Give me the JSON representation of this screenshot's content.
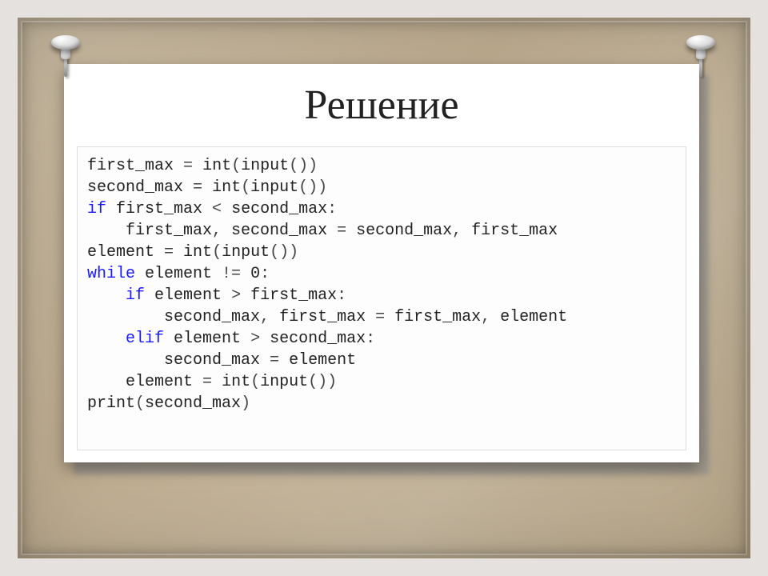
{
  "heading": "Решение",
  "code": {
    "lines": [
      [
        [
          "nm",
          "first_max "
        ],
        [
          "op",
          "="
        ],
        [
          "nm",
          " "
        ],
        [
          "fn",
          "int"
        ],
        [
          "op",
          "("
        ],
        [
          "fn",
          "input"
        ],
        [
          "op",
          "())"
        ]
      ],
      [
        [
          "nm",
          "second_max "
        ],
        [
          "op",
          "="
        ],
        [
          "nm",
          " "
        ],
        [
          "fn",
          "int"
        ],
        [
          "op",
          "("
        ],
        [
          "fn",
          "input"
        ],
        [
          "op",
          "())"
        ]
      ],
      [
        [
          "kw",
          "if"
        ],
        [
          "nm",
          " first_max "
        ],
        [
          "op",
          "<"
        ],
        [
          "nm",
          " second_max"
        ],
        [
          "op",
          ":"
        ]
      ],
      [
        [
          "nm",
          "    first_max"
        ],
        [
          "op",
          ","
        ],
        [
          "nm",
          " second_max "
        ],
        [
          "op",
          "="
        ],
        [
          "nm",
          " second_max"
        ],
        [
          "op",
          ","
        ],
        [
          "nm",
          " first_max"
        ]
      ],
      [
        [
          "nm",
          "element "
        ],
        [
          "op",
          "="
        ],
        [
          "nm",
          " "
        ],
        [
          "fn",
          "int"
        ],
        [
          "op",
          "("
        ],
        [
          "fn",
          "input"
        ],
        [
          "op",
          "())"
        ]
      ],
      [
        [
          "kw",
          "while"
        ],
        [
          "nm",
          " element "
        ],
        [
          "op",
          "!="
        ],
        [
          "nm",
          " "
        ],
        [
          "nm",
          "0"
        ],
        [
          "op",
          ":"
        ]
      ],
      [
        [
          "nm",
          "    "
        ],
        [
          "kw",
          "if"
        ],
        [
          "nm",
          " element "
        ],
        [
          "op",
          ">"
        ],
        [
          "nm",
          " first_max"
        ],
        [
          "op",
          ":"
        ]
      ],
      [
        [
          "nm",
          "        second_max"
        ],
        [
          "op",
          ","
        ],
        [
          "nm",
          " first_max "
        ],
        [
          "op",
          "="
        ],
        [
          "nm",
          " first_max"
        ],
        [
          "op",
          ","
        ],
        [
          "nm",
          " element"
        ]
      ],
      [
        [
          "nm",
          "    "
        ],
        [
          "kw",
          "elif"
        ],
        [
          "nm",
          " element "
        ],
        [
          "op",
          ">"
        ],
        [
          "nm",
          " second_max"
        ],
        [
          "op",
          ":"
        ]
      ],
      [
        [
          "nm",
          "        second_max "
        ],
        [
          "op",
          "="
        ],
        [
          "nm",
          " element"
        ]
      ],
      [
        [
          "nm",
          "    element "
        ],
        [
          "op",
          "="
        ],
        [
          "nm",
          " "
        ],
        [
          "fn",
          "int"
        ],
        [
          "op",
          "("
        ],
        [
          "fn",
          "input"
        ],
        [
          "op",
          "())"
        ]
      ],
      [
        [
          "fn",
          "print"
        ],
        [
          "op",
          "("
        ],
        [
          "nm",
          "second_max"
        ],
        [
          "op",
          ")"
        ]
      ]
    ]
  }
}
